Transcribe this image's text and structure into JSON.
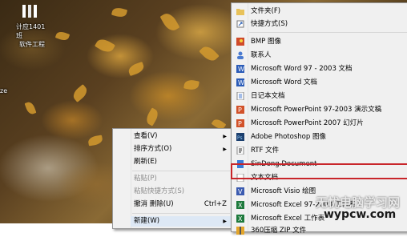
{
  "desktop": {
    "icon_label_line1": "计应1401班",
    "icon_label_line2": "软件工程",
    "left_edge_text": "ze"
  },
  "context_menu": {
    "items": [
      {
        "label": "查看(V)"
      },
      {
        "label": "排序方式(O)"
      },
      {
        "label": "刷新(E)"
      },
      {
        "label": "粘贴(P)"
      },
      {
        "label": "粘贴快捷方式(S)"
      },
      {
        "label": "撤消 删除(U)",
        "shortcut": "Ctrl+Z"
      },
      {
        "label": "新建(W)"
      }
    ]
  },
  "submenu": {
    "items": [
      {
        "label": "文件夹(F)",
        "icon": "folder-icon"
      },
      {
        "label": "快捷方式(S)",
        "icon": "shortcut-icon"
      },
      {
        "label": "BMP 图像",
        "icon": "bmp-image-icon"
      },
      {
        "label": "联系人",
        "icon": "contact-icon"
      },
      {
        "label": "Microsoft Word 97 - 2003 文档",
        "icon": "word-97-icon"
      },
      {
        "label": "Microsoft Word 文档",
        "icon": "word-icon"
      },
      {
        "label": "日记本文档",
        "icon": "journal-icon"
      },
      {
        "label": "Microsoft PowerPoint 97-2003 演示文稿",
        "icon": "powerpoint-97-icon"
      },
      {
        "label": "Microsoft PowerPoint 2007 幻灯片",
        "icon": "powerpoint-2007-icon"
      },
      {
        "label": "Adobe Photoshop 图像",
        "icon": "photoshop-icon"
      },
      {
        "label": "RTF 文件",
        "icon": "rtf-icon"
      },
      {
        "label": "SinDong.Document",
        "icon": "sindong-icon"
      },
      {
        "label": "文本文档",
        "icon": "text-document-icon"
      },
      {
        "label": "Microsoft Visio 绘图",
        "icon": "visio-icon"
      },
      {
        "label": "Microsoft Excel 97-2003 工作表",
        "icon": "excel-97-icon"
      },
      {
        "label": "Microsoft Excel 工作表",
        "icon": "excel-icon"
      },
      {
        "label": "360压缩 ZIP 文件",
        "icon": "zip-icon"
      }
    ]
  },
  "watermark": {
    "line1": "无忧电脑学习网",
    "line2": "wypcw.com"
  },
  "colors": {
    "highlight_box": "#c8252a"
  }
}
